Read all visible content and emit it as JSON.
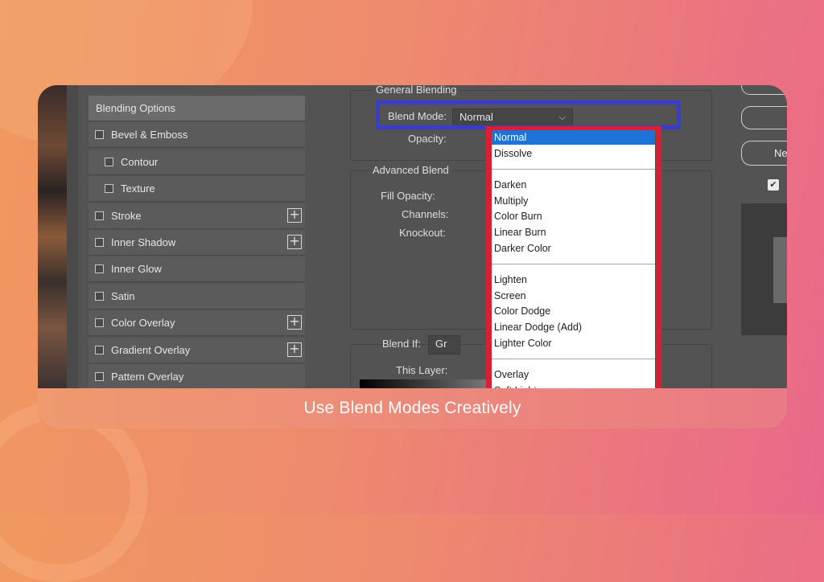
{
  "caption": "Use Blend Modes Creatively",
  "styles_panel": {
    "items": [
      {
        "label": "Blending Options",
        "checkbox": false,
        "indent": false,
        "plus": false,
        "selected": true
      },
      {
        "label": "Bevel & Emboss",
        "checkbox": true,
        "indent": false,
        "plus": false
      },
      {
        "label": "Contour",
        "checkbox": true,
        "indent": true,
        "plus": false
      },
      {
        "label": "Texture",
        "checkbox": true,
        "indent": true,
        "plus": false
      },
      {
        "label": "Stroke",
        "checkbox": true,
        "indent": false,
        "plus": true
      },
      {
        "label": "Inner Shadow",
        "checkbox": true,
        "indent": false,
        "plus": true
      },
      {
        "label": "Inner Glow",
        "checkbox": true,
        "indent": false,
        "plus": false
      },
      {
        "label": "Satin",
        "checkbox": true,
        "indent": false,
        "plus": false
      },
      {
        "label": "Color Overlay",
        "checkbox": true,
        "indent": false,
        "plus": true
      },
      {
        "label": "Gradient Overlay",
        "checkbox": true,
        "indent": false,
        "plus": true
      },
      {
        "label": "Pattern Overlay",
        "checkbox": true,
        "indent": false,
        "plus": false
      }
    ]
  },
  "general_blending": {
    "title": "General Blending",
    "blend_mode_label": "Blend Mode:",
    "blend_mode_value": "Normal",
    "opacity_label": "Opacity:"
  },
  "advanced_blending": {
    "title": "Advanced Blend",
    "fill_opacity_label": "Fill Opacity:",
    "channels_label": "Channels:",
    "knockout_label": "Knockout:"
  },
  "blend_if": {
    "label": "Blend If:",
    "value": "Gr",
    "this_layer_label": "This Layer:"
  },
  "blend_mode_options": [
    [
      "Normal",
      "Dissolve"
    ],
    [
      "Darken",
      "Multiply",
      "Color Burn",
      "Linear Burn",
      "Darker Color"
    ],
    [
      "Lighten",
      "Screen",
      "Color Dodge",
      "Linear Dodge (Add)",
      "Lighter Color"
    ],
    [
      "Overlay",
      "Soft Light"
    ]
  ],
  "selected_blend_mode": "Normal",
  "right_panel": {
    "new_button_label": "Ne",
    "preview_checked": true
  },
  "colors": {
    "blue_highlight": "#3a3ccf",
    "red_highlight": "#dc1d33",
    "selected_option": "#1e73d8"
  }
}
